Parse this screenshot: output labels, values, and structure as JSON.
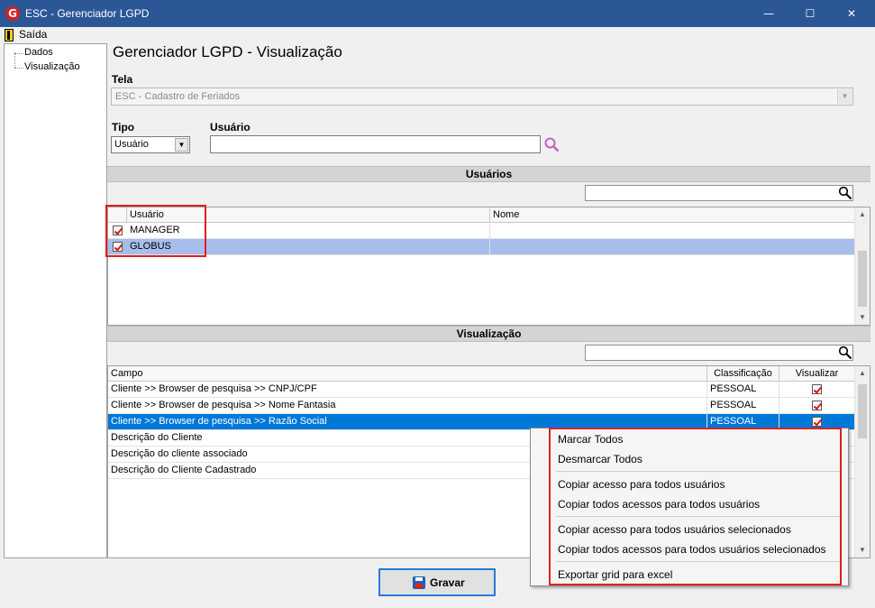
{
  "window": {
    "app_icon": "G",
    "title": "ESC - Gerenciador LGPD",
    "controls": {
      "minimize": "—",
      "maximize": "☐",
      "close": "✕"
    }
  },
  "menubar": {
    "exit_label": "Saída"
  },
  "sidebar": {
    "items": [
      {
        "label": "Dados"
      },
      {
        "label": "Visualização"
      }
    ]
  },
  "main": {
    "title": "Gerenciador LGPD - Visualização",
    "tela": {
      "label": "Tela",
      "value": "ESC - Cadastro de Feriados"
    },
    "tipo": {
      "label": "Tipo",
      "value": "Usuário"
    },
    "usuario": {
      "label": "Usuário",
      "value": ""
    }
  },
  "users_section": {
    "title": "Usuários",
    "search_value": "",
    "columns": [
      "Usuário",
      "Nome"
    ],
    "rows": [
      {
        "checked": true,
        "usuario": "MANAGER",
        "nome": "",
        "selected": false
      },
      {
        "checked": true,
        "usuario": "GLOBUS",
        "nome": "",
        "selected": true
      }
    ]
  },
  "view_section": {
    "title": "Visualização",
    "search_value": "",
    "columns": [
      "Campo",
      "Classificação",
      "Visualizar"
    ],
    "rows": [
      {
        "campo": "Cliente >> Browser de pesquisa >> CNPJ/CPF",
        "classificacao": "PESSOAL",
        "visualizar": true,
        "selected": false
      },
      {
        "campo": "Cliente >> Browser de pesquisa >> Nome Fantasia",
        "classificacao": "PESSOAL",
        "visualizar": true,
        "selected": false
      },
      {
        "campo": "Cliente >> Browser de pesquisa >> Razão Social",
        "classificacao": "PESSOAL",
        "visualizar": true,
        "selected": true
      },
      {
        "campo": "Descrição do Cliente",
        "classificacao": "",
        "visualizar": null,
        "selected": false
      },
      {
        "campo": "Descrição do cliente associado",
        "classificacao": "",
        "visualizar": null,
        "selected": false
      },
      {
        "campo": "Descrição do Cliente Cadastrado",
        "classificacao": "",
        "visualizar": null,
        "selected": false
      }
    ]
  },
  "context_menu": {
    "items": [
      {
        "label": "Marcar Todos"
      },
      {
        "label": "Desmarcar Todos"
      },
      {
        "label": "Copiar acesso para todos usuários"
      },
      {
        "label": "Copiar todos acessos para todos usuários"
      },
      {
        "label": "Copiar acesso para todos usuários selecionados"
      },
      {
        "label": "Copiar todos acessos para todos usuários selecionados"
      },
      {
        "label": "Exportar grid para excel"
      }
    ]
  },
  "save_button": {
    "label": "Gravar"
  },
  "colors": {
    "titlebar": "#2b5797",
    "row_selected_users": "#a7bdeb",
    "row_selected_view": "#0078d7",
    "highlight_box": "#e41e1e",
    "check_mark": "#e01010"
  },
  "icons": [
    "app-logo-icon",
    "exit-door-icon",
    "search-icon",
    "dropdown-arrow-icon",
    "floppy-disk-icon"
  ]
}
